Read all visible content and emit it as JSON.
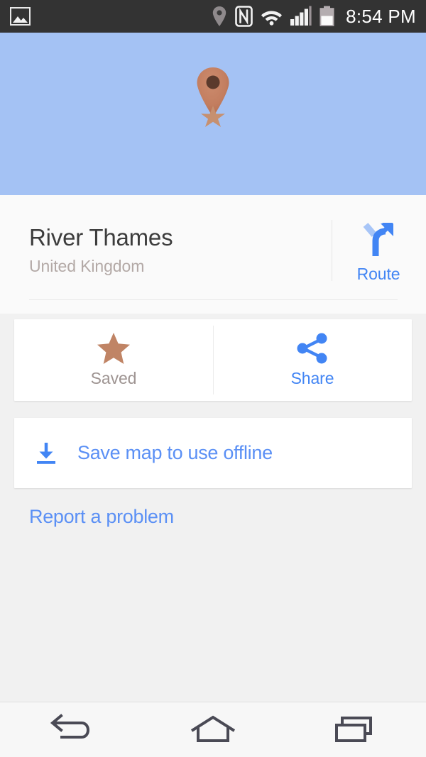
{
  "statusbar": {
    "time": "8:54 PM",
    "icons": [
      {
        "name": "screenshot-image-icon",
        "label": "image"
      },
      {
        "name": "location-pin-icon",
        "label": "location"
      },
      {
        "name": "nfc-icon",
        "label": "NFC"
      },
      {
        "name": "wifi-icon",
        "label": "wifi"
      },
      {
        "name": "cellular-signal-icon",
        "label": "signal"
      },
      {
        "name": "battery-icon",
        "label": "battery"
      }
    ]
  },
  "map": {
    "pin_icon": "map-pin-starred-icon",
    "water_color": "#a4c2f4",
    "pin_color": "#c07a5c"
  },
  "place": {
    "title": "River Thames",
    "subtitle": "United Kingdom"
  },
  "route": {
    "label": "Route",
    "icon": "route-fork-arrow-icon",
    "color": "#4285f4"
  },
  "actions": [
    {
      "label": "Saved",
      "icon": "star-filled-icon",
      "color": "#c08465"
    },
    {
      "label": "Share",
      "icon": "share-nodes-icon",
      "color": "#4285f4"
    }
  ],
  "offline": {
    "label": "Save map to use offline",
    "icon": "download-icon",
    "color": "#5b90f5"
  },
  "report": {
    "label": "Report a problem",
    "color": "#5b90f5"
  },
  "navbar": {
    "buttons": [
      {
        "name": "back-button",
        "icon": "back-arrow-icon"
      },
      {
        "name": "home-button",
        "icon": "home-icon"
      },
      {
        "name": "recents-button",
        "icon": "recents-icon"
      }
    ]
  }
}
